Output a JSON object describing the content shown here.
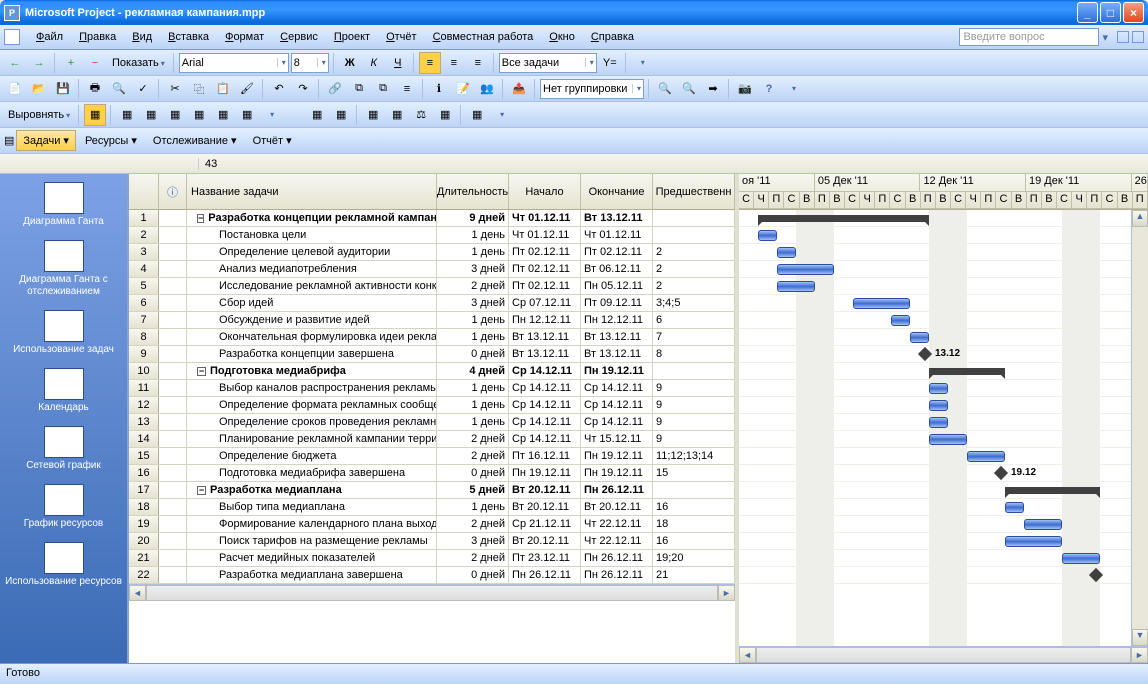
{
  "app": {
    "title": "Microsoft Project - рекламная кампания.mpp"
  },
  "menu": {
    "items": [
      "Файл",
      "Правка",
      "Вид",
      "Вставка",
      "Формат",
      "Сервис",
      "Проект",
      "Отчёт",
      "Совместная работа",
      "Окно",
      "Справка"
    ],
    "help_placeholder": "Введите вопрос"
  },
  "toolbar1": {
    "show_label": "Показать",
    "font_name": "Arial",
    "font_size": "8",
    "all_tasks": "Все задачи"
  },
  "toolbar2": {
    "no_grouping": "Нет группировки"
  },
  "toolbar3": {
    "align_label": "Выровнять"
  },
  "viewbar": {
    "tasks": "Задачи",
    "resources": "Ресурсы",
    "tracking": "Отслеживание",
    "report": "Отчёт"
  },
  "entry_value": "43",
  "sidebar": [
    {
      "label": "Диаграмма Ганта"
    },
    {
      "label": "Диаграмма Ганта с отслеживанием"
    },
    {
      "label": "Использование задач"
    },
    {
      "label": "Календарь"
    },
    {
      "label": "Сетевой график"
    },
    {
      "label": "График ресурсов"
    },
    {
      "label": "Использование ресурсов"
    }
  ],
  "columns": {
    "name": "Название задачи",
    "duration": "Длительность",
    "start": "Начало",
    "finish": "Окончание",
    "predecessors": "Предшественн"
  },
  "timeline": {
    "weeks": [
      "оя '11",
      "05 Дек '11",
      "12 Дек '11",
      "19 Дек '11",
      "26"
    ],
    "days": [
      "С",
      "Ч",
      "П",
      "С",
      "В",
      "П",
      "В",
      "С",
      "Ч",
      "П",
      "С",
      "В",
      "П",
      "В",
      "С",
      "Ч",
      "П",
      "С",
      "В",
      "П",
      "В",
      "С",
      "Ч",
      "П",
      "С",
      "В",
      "П"
    ]
  },
  "tasks": [
    {
      "n": 1,
      "lvl": 0,
      "sum": true,
      "name": "Разработка концепции рекламной кампании",
      "dur": "9 дней",
      "start": "Чт 01.12.11",
      "end": "Вт 13.12.11",
      "pred": "",
      "gl": 19,
      "gw": 171,
      "type": "sum"
    },
    {
      "n": 2,
      "lvl": 1,
      "name": "Постановка цели",
      "dur": "1 день",
      "start": "Чт 01.12.11",
      "end": "Чт 01.12.11",
      "pred": "",
      "gl": 19,
      "gw": 19,
      "type": "task"
    },
    {
      "n": 3,
      "lvl": 1,
      "name": "Определение целевой аудитории",
      "dur": "1 день",
      "start": "Пт 02.12.11",
      "end": "Пт 02.12.11",
      "pred": "2",
      "gl": 38,
      "gw": 19,
      "type": "task"
    },
    {
      "n": 4,
      "lvl": 1,
      "name": "Анализ медиапотребления",
      "dur": "3 дней",
      "start": "Пт 02.12.11",
      "end": "Вт 06.12.11",
      "pred": "2",
      "gl": 38,
      "gw": 57,
      "type": "task"
    },
    {
      "n": 5,
      "lvl": 1,
      "name": "Исследование рекламной активности конкур",
      "dur": "2 дней",
      "start": "Пт 02.12.11",
      "end": "Пн 05.12.11",
      "pred": "2",
      "gl": 38,
      "gw": 38,
      "type": "task"
    },
    {
      "n": 6,
      "lvl": 1,
      "name": "Сбор идей",
      "dur": "3 дней",
      "start": "Ср 07.12.11",
      "end": "Пт 09.12.11",
      "pred": "3;4;5",
      "gl": 114,
      "gw": 57,
      "type": "task"
    },
    {
      "n": 7,
      "lvl": 1,
      "name": "Обсуждение и развитие идей",
      "dur": "1 день",
      "start": "Пн 12.12.11",
      "end": "Пн 12.12.11",
      "pred": "6",
      "gl": 152,
      "gw": 19,
      "type": "task"
    },
    {
      "n": 8,
      "lvl": 1,
      "name": "Окончательная формулировка идеи рекламнс",
      "dur": "1 день",
      "start": "Вт 13.12.11",
      "end": "Вт 13.12.11",
      "pred": "7",
      "gl": 171,
      "gw": 19,
      "type": "task"
    },
    {
      "n": 9,
      "lvl": 1,
      "name": "Разработка концепции завершена",
      "dur": "0 дней",
      "start": "Вт 13.12.11",
      "end": "Вт 13.12.11",
      "pred": "8",
      "gl": 186,
      "gw": 0,
      "type": "ms",
      "ms_label": "13.12"
    },
    {
      "n": 10,
      "lvl": 0,
      "sum": true,
      "name": "Подготовка медиабрифа",
      "dur": "4 дней",
      "start": "Ср 14.12.11",
      "end": "Пн 19.12.11",
      "pred": "",
      "gl": 190,
      "gw": 76,
      "type": "sum"
    },
    {
      "n": 11,
      "lvl": 1,
      "name": "Выбор каналов распространения рекламы",
      "dur": "1 день",
      "start": "Ср 14.12.11",
      "end": "Ср 14.12.11",
      "pred": "9",
      "gl": 190,
      "gw": 19,
      "type": "task"
    },
    {
      "n": 12,
      "lvl": 1,
      "name": "Определение формата рекламных сообщений",
      "dur": "1 день",
      "start": "Ср 14.12.11",
      "end": "Ср 14.12.11",
      "pred": "9",
      "gl": 190,
      "gw": 19,
      "type": "task"
    },
    {
      "n": 13,
      "lvl": 1,
      "name": "Определение сроков проведения рекламной к",
      "dur": "1 день",
      "start": "Ср 14.12.11",
      "end": "Ср 14.12.11",
      "pred": "9",
      "gl": 190,
      "gw": 19,
      "type": "task"
    },
    {
      "n": 14,
      "lvl": 1,
      "name": "Планирование рекламной кампании территор",
      "dur": "2 дней",
      "start": "Ср 14.12.11",
      "end": "Чт 15.12.11",
      "pred": "9",
      "gl": 190,
      "gw": 38,
      "type": "task"
    },
    {
      "n": 15,
      "lvl": 1,
      "name": "Определение бюджета",
      "dur": "2 дней",
      "start": "Пт 16.12.11",
      "end": "Пн 19.12.11",
      "pred": "11;12;13;14",
      "gl": 228,
      "gw": 38,
      "type": "task"
    },
    {
      "n": 16,
      "lvl": 1,
      "name": "Подготовка медиабрифа завершена",
      "dur": "0 дней",
      "start": "Пн 19.12.11",
      "end": "Пн 19.12.11",
      "pred": "15",
      "gl": 262,
      "gw": 0,
      "type": "ms",
      "ms_label": "19.12"
    },
    {
      "n": 17,
      "lvl": 0,
      "sum": true,
      "name": "Разработка медиаплана",
      "dur": "5 дней",
      "start": "Вт 20.12.11",
      "end": "Пн 26.12.11",
      "pred": "",
      "gl": 266,
      "gw": 95,
      "type": "sum"
    },
    {
      "n": 18,
      "lvl": 1,
      "name": "Выбор типа медиаплана",
      "dur": "1 день",
      "start": "Вт 20.12.11",
      "end": "Вт 20.12.11",
      "pred": "16",
      "gl": 266,
      "gw": 19,
      "type": "task"
    },
    {
      "n": 19,
      "lvl": 1,
      "name": "Формирование календарного плана выхода р",
      "dur": "2 дней",
      "start": "Ср 21.12.11",
      "end": "Чт 22.12.11",
      "pred": "18",
      "gl": 285,
      "gw": 38,
      "type": "task"
    },
    {
      "n": 20,
      "lvl": 1,
      "name": "Поиск тарифов на размещение рекламы",
      "dur": "3 дней",
      "start": "Вт 20.12.11",
      "end": "Чт 22.12.11",
      "pred": "16",
      "gl": 266,
      "gw": 57,
      "type": "task"
    },
    {
      "n": 21,
      "lvl": 1,
      "name": "Расчет медийных показателей",
      "dur": "2 дней",
      "start": "Пт 23.12.11",
      "end": "Пн 26.12.11",
      "pred": "19;20",
      "gl": 323,
      "gw": 38,
      "type": "task"
    },
    {
      "n": 22,
      "lvl": 1,
      "name": "Разработка медиаплана завершена",
      "dur": "0 дней",
      "start": "Пн 26.12.11",
      "end": "Пн 26.12.11",
      "pred": "21",
      "gl": 357,
      "gw": 0,
      "type": "ms",
      "ms_label": ""
    }
  ],
  "status": "Готово"
}
